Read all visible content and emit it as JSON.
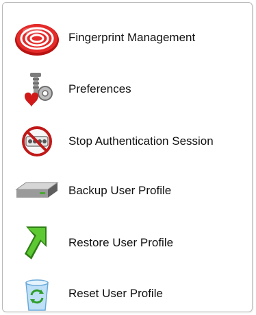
{
  "menu": {
    "items": [
      {
        "label": "Fingerprint Management",
        "icon": "fingerprint-icon"
      },
      {
        "label": "Preferences",
        "icon": "preferences-icon"
      },
      {
        "label": "Stop Authentication Session",
        "icon": "stop-session-icon"
      },
      {
        "label": "Backup User Profile",
        "icon": "backup-drive-icon"
      },
      {
        "label": "Restore User Profile",
        "icon": "restore-arrow-icon"
      },
      {
        "label": "Reset User Profile",
        "icon": "recycle-bin-icon"
      }
    ]
  },
  "colors": {
    "fingerprint_red": "#d81b1b",
    "heart_red": "#d01a1a",
    "restore_green": "#3aa81e",
    "recycle_blue": "#3b8fd6",
    "drive_gray": "#8a8a8a",
    "panel_border": "#b9b9b9"
  }
}
